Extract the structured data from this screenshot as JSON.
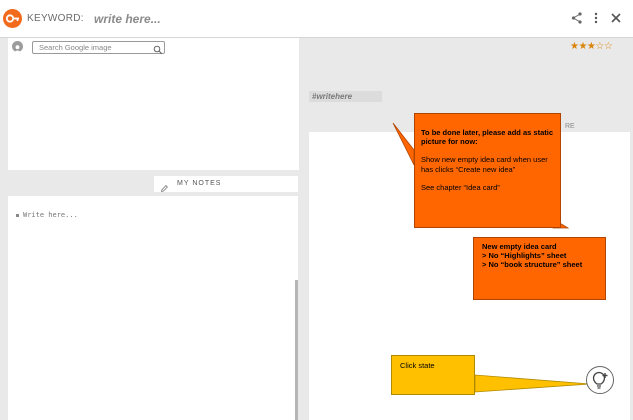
{
  "header": {
    "keyword_label": "KEYWORD:",
    "keyword_placeholder": "write here...",
    "icons": [
      "key-logo-icon",
      "share-icon",
      "more-vertical-icon",
      "close-icon"
    ]
  },
  "image_search": {
    "placeholder": "Search Google image",
    "icons": [
      "user-avatar-icon",
      "search-icon"
    ]
  },
  "rating": {
    "stars_text": "★★★☆☆",
    "value": 3.5,
    "max": 5,
    "color": "#d9850b"
  },
  "tag": {
    "text": "#writehere"
  },
  "notes": {
    "tab_label": "MY NOTES",
    "item": "Write here...",
    "icons": [
      "edit-icon"
    ]
  },
  "right_panel": {
    "clipped_label": "RE"
  },
  "annotations": {
    "note1": {
      "title": "To be done later, please add as static picture for now:",
      "line1": "Show new empty idea card when user has clicks “Create new idea”",
      "line2": "See chapter “Idea card”",
      "color": "#ff6600"
    },
    "note2": {
      "line1": "New empty idea card",
      "line2": "> No “Highlights” sheet",
      "line3": "> No “book structure” sheet",
      "color": "#ff6600"
    },
    "note3": {
      "text": "Click state",
      "color": "#ffc000"
    }
  },
  "fab": {
    "icon": "lightbulb-plus-icon"
  }
}
